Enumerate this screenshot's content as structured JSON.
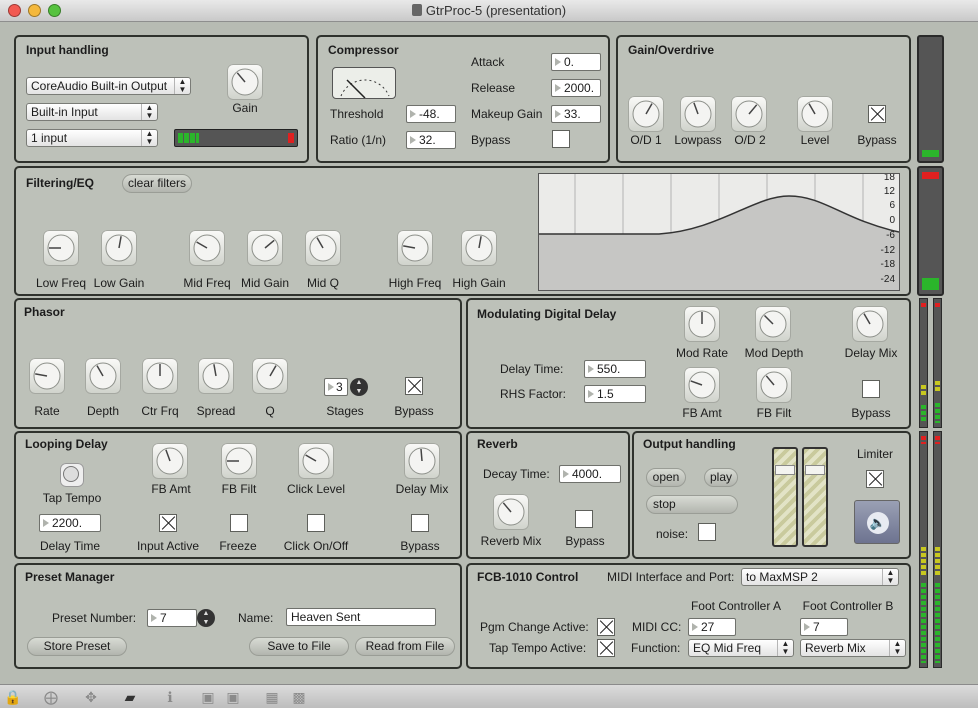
{
  "window": {
    "title": "GtrProc-5 (presentation)"
  },
  "input_handling": {
    "title": "Input handling",
    "audio_driver": "CoreAudio Built-in Output",
    "input_device": "Built-in Input",
    "input_count": "1 input",
    "gain_label": "Gain",
    "meter_level": 0.18
  },
  "compressor": {
    "title": "Compressor",
    "threshold_label": "Threshold",
    "threshold_value": "-48.",
    "ratio_label": "Ratio (1/n)",
    "ratio_value": "32.",
    "attack_label": "Attack",
    "attack_value": "0.",
    "release_label": "Release",
    "release_value": "2000.",
    "makeup_label": "Makeup Gain",
    "makeup_value": "33.",
    "bypass_label": "Bypass",
    "bypass": false
  },
  "gain_overdrive": {
    "title": "Gain/Overdrive",
    "od1_label": "O/D 1",
    "lowpass_label": "Lowpass",
    "od2_label": "O/D 2",
    "level_label": "Level",
    "bypass_label": "Bypass",
    "bypass": true
  },
  "filtering": {
    "title": "Filtering/EQ",
    "clear_label": "clear filters",
    "knobs": [
      "Low Freq",
      "Low Gain",
      "Mid Freq",
      "Mid Gain",
      "Mid Q",
      "High Freq",
      "High Gain"
    ],
    "scale_labels": [
      "18",
      "12",
      "6",
      "0",
      "-6",
      "-12",
      "-18",
      "-24"
    ]
  },
  "phasor": {
    "title": "Phasor",
    "knobs": [
      "Rate",
      "Depth",
      "Ctr Frq",
      "Spread",
      "Q"
    ],
    "stages_label": "Stages",
    "stages_value": "3",
    "bypass_label": "Bypass",
    "bypass": true
  },
  "mod_delay": {
    "title": "Modulating Digital Delay",
    "delay_time_label": "Delay Time:",
    "delay_time_value": "550.",
    "rhs_label": "RHS Factor:",
    "rhs_value": "1.5",
    "mod_rate_label": "Mod Rate",
    "mod_depth_label": "Mod Depth",
    "delay_mix_label": "Delay Mix",
    "fb_amt_label": "FB Amt",
    "fb_filt_label": "FB Filt",
    "bypass_label": "Bypass",
    "bypass": false
  },
  "looping_delay": {
    "title": "Looping Delay",
    "tap_label": "Tap Tempo",
    "fb_amt_label": "FB Amt",
    "fb_filt_label": "FB Filt",
    "click_level_label": "Click Level",
    "delay_mix_label": "Delay Mix",
    "delay_time_value": "2200.",
    "delay_time_label": "Delay Time",
    "input_active_label": "Input Active",
    "input_active": true,
    "freeze_label": "Freeze",
    "freeze": false,
    "click_label": "Click On/Off",
    "click": false,
    "bypass_label": "Bypass",
    "bypass": false
  },
  "reverb": {
    "title": "Reverb",
    "decay_label": "Decay Time:",
    "decay_value": "4000.",
    "mix_label": "Reverb Mix",
    "bypass_label": "Bypass",
    "bypass": false
  },
  "output": {
    "title": "Output handling",
    "open_label": "open",
    "play_label": "play",
    "stop_label": "stop",
    "noise_label": "noise:",
    "noise": false,
    "limiter_label": "Limiter",
    "limiter": true,
    "speaker_icon": "speaker-icon"
  },
  "preset": {
    "title": "Preset Manager",
    "number_label": "Preset Number:",
    "number_value": "7",
    "name_label": "Name:",
    "name_value": "Heaven Sent",
    "store_label": "Store Preset",
    "save_label": "Save to File",
    "read_label": "Read from File"
  },
  "fcb": {
    "title": "FCB-1010 Control",
    "midi_port_label": "MIDI Interface and Port:",
    "midi_port_value": "to MaxMSP 2",
    "foot_a_label": "Foot Controller A",
    "foot_b_label": "Foot Controller B",
    "pgm_label": "Pgm Change Active:",
    "pgm": true,
    "tap_label": "Tap Tempo Active:",
    "tap": true,
    "midi_cc_label": "MIDI CC:",
    "cc_a": "27",
    "cc_b": "7",
    "function_label": "Function:",
    "func_a": "EQ Mid Freq",
    "func_b": "Reverb Mix"
  },
  "colors": {
    "panel": "#bdc1b9",
    "meter_green": "#2bb52b",
    "meter_red": "#e02020",
    "meter_yellow": "#c8c820"
  }
}
